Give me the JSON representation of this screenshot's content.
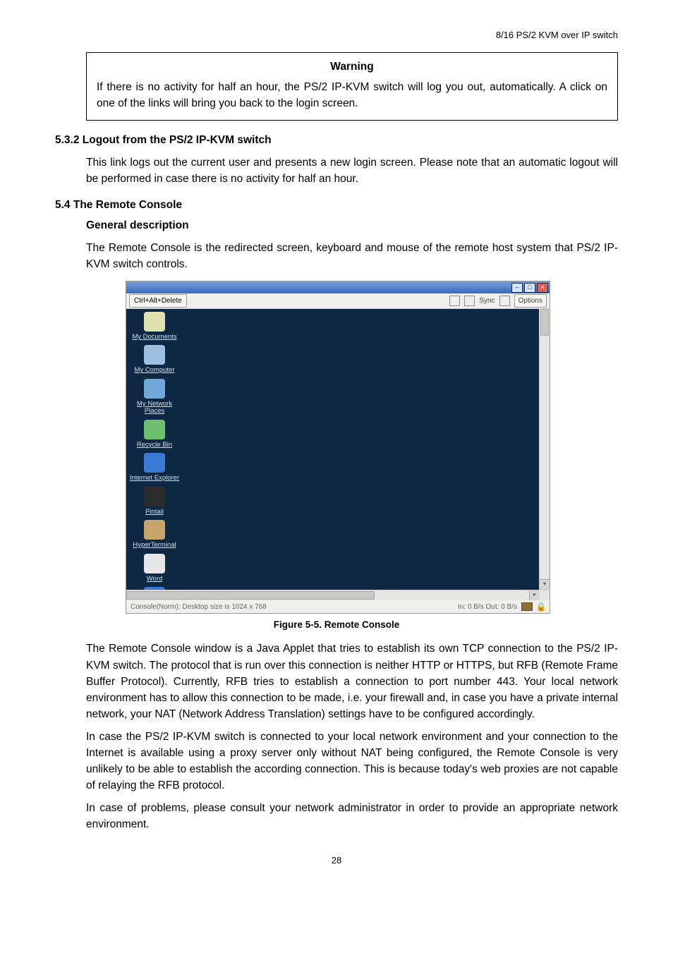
{
  "header": {
    "product": "8/16 PS/2 KVM over IP switch"
  },
  "warning": {
    "title": "Warning",
    "body": "If there is no activity for half an hour, the PS/2 IP-KVM switch will log you out, automatically. A click on one of the links will bring you back to the login screen."
  },
  "section_532": {
    "heading": "5.3.2   Logout from the PS/2 IP-KVM switch",
    "body": "This link logs out the current user and presents a new login screen. Please note that an automatic logout will be performed in case there is no activity for half an hour."
  },
  "section_54": {
    "heading": "5.4 The Remote Console",
    "subheading": "General description",
    "intro": "The Remote Console is the redirected screen, keyboard and mouse of the remote host system that PS/2 IP-KVM switch controls."
  },
  "figure": {
    "caption": "Figure 5-5. Remote Console",
    "toolbar": {
      "cad": "Ctrl+Alt+Delete",
      "sync": "Sync",
      "options": "Options"
    },
    "status": {
      "left": "Console(Norm): Desktop size is 1024 x 768",
      "right": "In: 0 B/s Out: 0 B/s"
    },
    "desktop_icons": [
      {
        "label": "My Documents",
        "bg": "#e0e0b0"
      },
      {
        "label": "My Computer",
        "bg": "#9ec0e0"
      },
      {
        "label": "My Network Places",
        "bg": "#6fa8d8"
      },
      {
        "label": "Recycle Bin",
        "bg": "#6fbf70"
      },
      {
        "label": "Internet Explorer",
        "bg": "#3a7ad4"
      },
      {
        "label": "Pintail",
        "bg": "#2b2b2b"
      },
      {
        "label": "HyperTerminal",
        "bg": "#c7a56a"
      },
      {
        "label": "Word",
        "bg": "#e6e6ea"
      },
      {
        "label": "",
        "bg": "#3a7ad4"
      }
    ]
  },
  "body_text": {
    "p1": "The Remote Console window is a Java Applet that tries to establish its own TCP connection to the PS/2 IP-KVM switch. The protocol that is run over this connection is neither HTTP or HTTPS, but RFB (Remote Frame Buffer Protocol). Currently, RFB tries to establish a connection to port number 443. Your local network environment has to allow this connection to be made, i.e. your firewall and, in case you have a private internal network, your NAT (Network Address Translation) settings have to be configured accordingly.",
    "p2": "In case the PS/2 IP-KVM switch is connected to your local network environment and your connection to the Internet is available using a proxy server only without NAT being configured, the Remote Console is very unlikely to be able to establish the according connection. This is because today's web proxies are not capable of relaying the RFB protocol.",
    "p3": "In case of problems, please consult your network administrator in order to provide an appropriate network environment."
  },
  "page": "28"
}
